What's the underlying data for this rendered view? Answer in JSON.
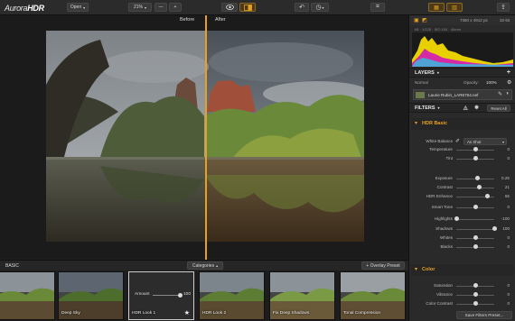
{
  "toolbar": {
    "app_name_a": "Aurora",
    "app_name_b": "HDR",
    "open_label": "Open",
    "zoom_label": "21%",
    "zoom_out": "—",
    "zoom_in": "+",
    "size_info": "7360 x 4912 px",
    "bit_depth": "32-bit",
    "exif": "f/8 · 1/125 · ISO 100 · 40mm"
  },
  "canvas": {
    "before_label": "Before",
    "after_label": "After"
  },
  "filmstrip": {
    "category_label": "BASIC",
    "categories_button": "Categories",
    "overlay_button": "+ Overlay Preset",
    "thumbs": [
      {
        "caption": ""
      },
      {
        "caption": "Deep Sky"
      },
      {
        "caption": "HDR Look 1",
        "amount_label": "Amount",
        "amount_value": "100"
      },
      {
        "caption": "HDR Look 2"
      },
      {
        "caption": "Fix Deep Shadows"
      },
      {
        "caption": "Tonal Compression"
      }
    ]
  },
  "layers": {
    "title": "LAYERS",
    "blend_mode": "Normal",
    "opacity_label": "Opacity:",
    "opacity_value": "100%",
    "layer_name": "Laurie Rubin_LAR6764.nef"
  },
  "filters": {
    "title": "FILTERS",
    "reset_label": "Reset All",
    "hdr_basic_title": "HDR Basic",
    "white_balance_label": "White Balance",
    "white_balance_value": "As Shot",
    "rows": [
      {
        "label": "Temperature",
        "value": "0",
        "pos": 0.5
      },
      {
        "label": "Tint",
        "value": "0",
        "pos": 0.5
      },
      {
        "label": "Exposure",
        "value": "0.25",
        "pos": 0.55
      },
      {
        "label": "Contrast",
        "value": "21",
        "pos": 0.6
      },
      {
        "label": "HDR Enhance",
        "value": "65",
        "pos": 0.82
      },
      {
        "label": "Smart Tone",
        "value": "0",
        "pos": 0.5
      },
      {
        "label": "Highlights",
        "value": "-100",
        "pos": 0.0
      },
      {
        "label": "Shadows",
        "value": "100",
        "pos": 1.0
      },
      {
        "label": "Whites",
        "value": "0",
        "pos": 0.5
      },
      {
        "label": "Blacks",
        "value": "0",
        "pos": 0.5
      }
    ],
    "color_title": "Color",
    "color_rows": [
      {
        "label": "Saturation",
        "value": "0",
        "pos": 0.5
      },
      {
        "label": "Vibrance",
        "value": "0",
        "pos": 0.5
      },
      {
        "label": "Color Contrast",
        "value": "0",
        "pos": 0.5
      }
    ],
    "save_preset_label": "Save Filters Preset..."
  },
  "colors": {
    "accent": "#e8a020",
    "panel": "#2a2a2a",
    "histogram_yellow": "#e8d000",
    "histogram_magenta": "#d000d0"
  }
}
